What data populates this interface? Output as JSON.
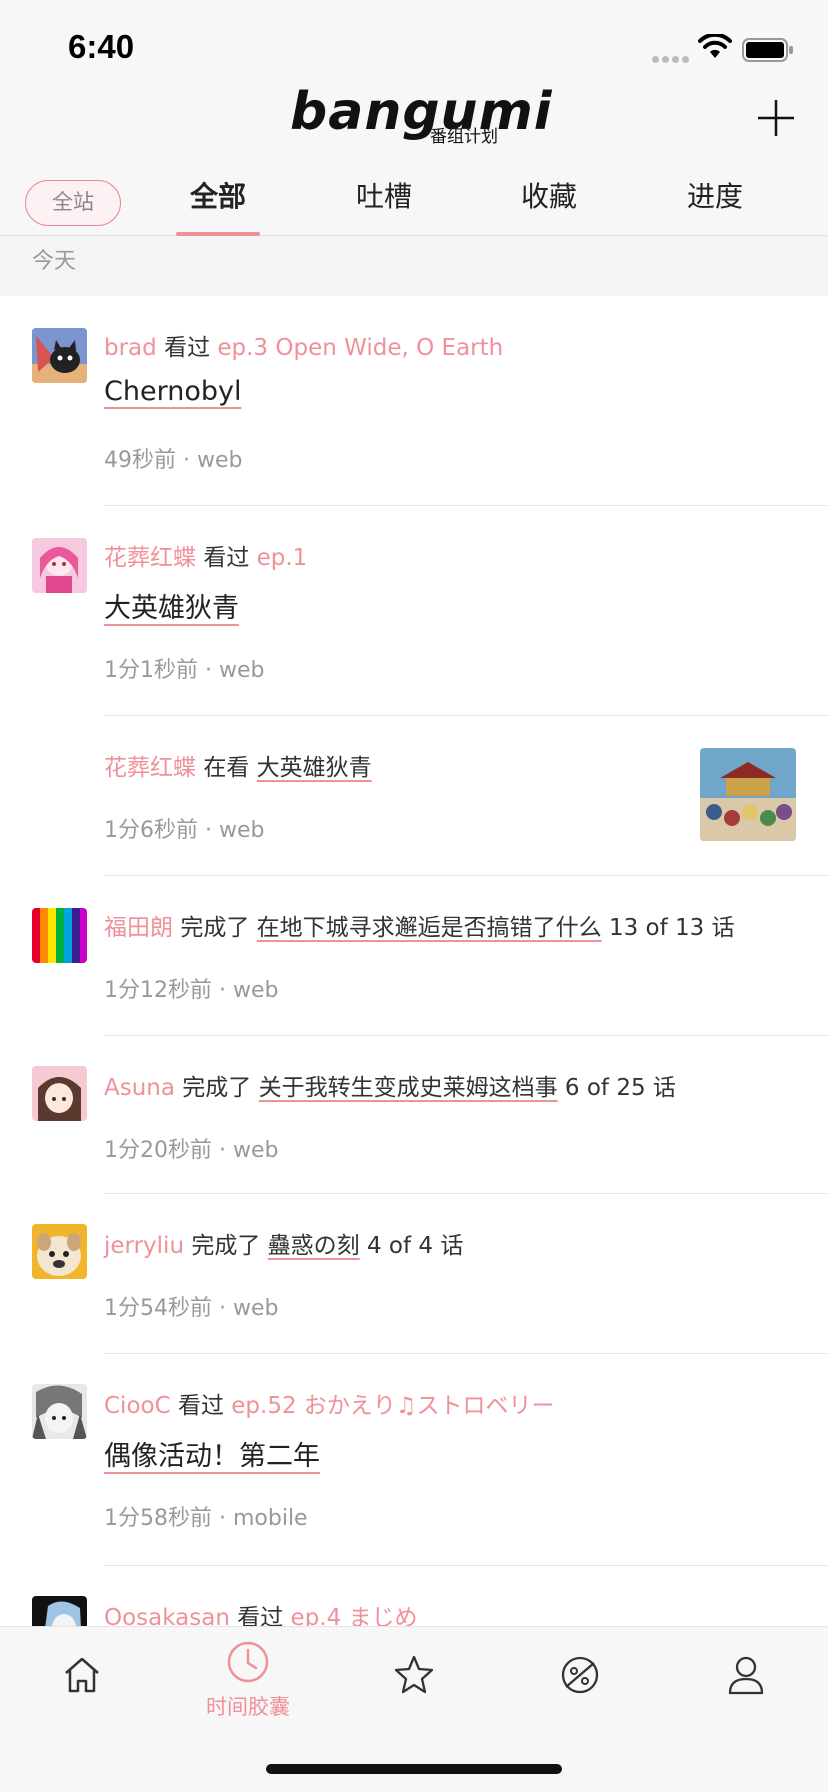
{
  "status_bar": {
    "time": "6:40"
  },
  "header": {
    "logo_word": "bangumi",
    "logo_sub": "番组计划",
    "scope_button": "全站",
    "tabs": [
      {
        "label": "全部",
        "active": true
      },
      {
        "label": "吐槽",
        "active": false
      },
      {
        "label": "收藏",
        "active": false
      },
      {
        "label": "进度",
        "active": false
      }
    ]
  },
  "section": {
    "title": "今天"
  },
  "feed": [
    {
      "user": "brad",
      "action": "看过",
      "detail": "ep.3 Open Wide, O Earth",
      "subject": "Chernobyl",
      "time": "49秒前 · web"
    },
    {
      "user": "花葬红蝶",
      "action": "看过",
      "detail": "ep.1",
      "subject": "大英雄狄青",
      "time": "1分1秒前 · web"
    },
    {
      "user": "花葬红蝶",
      "action": "在看",
      "subject": "大英雄狄青",
      "time": "1分6秒前 · web"
    },
    {
      "user": "福田朗",
      "action": "完成了",
      "subject": "在地下城寻求邂逅是否搞错了什么",
      "progress": "13 of 13 话",
      "time": "1分12秒前 · web"
    },
    {
      "user": "Asuna",
      "action": "完成了",
      "subject": "关于我转生变成史莱姆这档事",
      "progress": "6 of 25 话",
      "time": "1分20秒前 · web"
    },
    {
      "user": "jerryliu",
      "action": "完成了",
      "subject": "蠱惑の刻",
      "progress": "4 of 4 话",
      "time": "1分54秒前 · web"
    },
    {
      "user": "CiooC",
      "action": "看过",
      "detail": "ep.52 おかえり♫ストロベリー",
      "subject": "偶像活动！第二年",
      "time": "1分58秒前 · mobile"
    },
    {
      "user": "Oosakasan",
      "action": "看过",
      "detail": "ep.4 まじめ"
    }
  ],
  "tabbar": {
    "active_label": "时间胶囊"
  },
  "colors": {
    "accent": "#f09199"
  }
}
